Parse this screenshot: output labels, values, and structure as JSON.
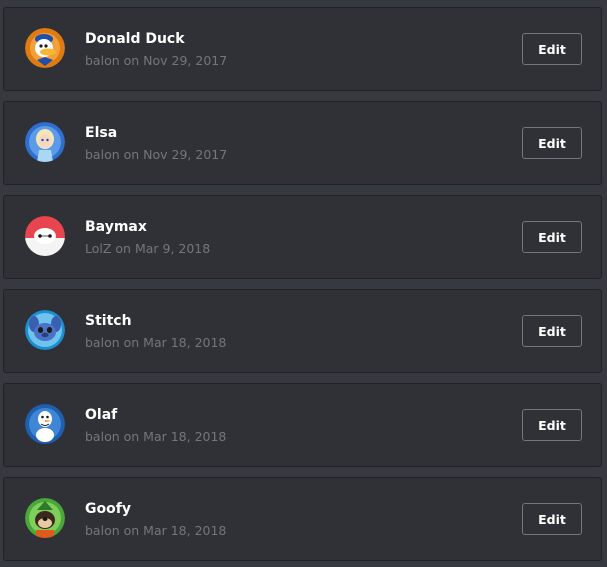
{
  "emojis": [
    {
      "name": "Donald Duck",
      "meta": "balon on Nov 29, 2017",
      "edit_label": "Edit",
      "avatar_icon": "donald-duck-icon"
    },
    {
      "name": "Elsa",
      "meta": "balon on Nov 29, 2017",
      "edit_label": "Edit",
      "avatar_icon": "elsa-icon"
    },
    {
      "name": "Baymax",
      "meta": "LolZ on Mar 9, 2018",
      "edit_label": "Edit",
      "avatar_icon": "baymax-icon"
    },
    {
      "name": "Stitch",
      "meta": "balon on Mar 18, 2018",
      "edit_label": "Edit",
      "avatar_icon": "stitch-icon"
    },
    {
      "name": "Olaf",
      "meta": "balon on Mar 18, 2018",
      "edit_label": "Edit",
      "avatar_icon": "olaf-icon"
    },
    {
      "name": "Goofy",
      "meta": "balon on Mar 18, 2018",
      "edit_label": "Edit",
      "avatar_icon": "goofy-icon"
    }
  ],
  "colors": {
    "background": "#36393f",
    "card": "#2f3136",
    "card_border": "#202225",
    "text_primary": "#ffffff",
    "text_muted": "#72767d"
  }
}
